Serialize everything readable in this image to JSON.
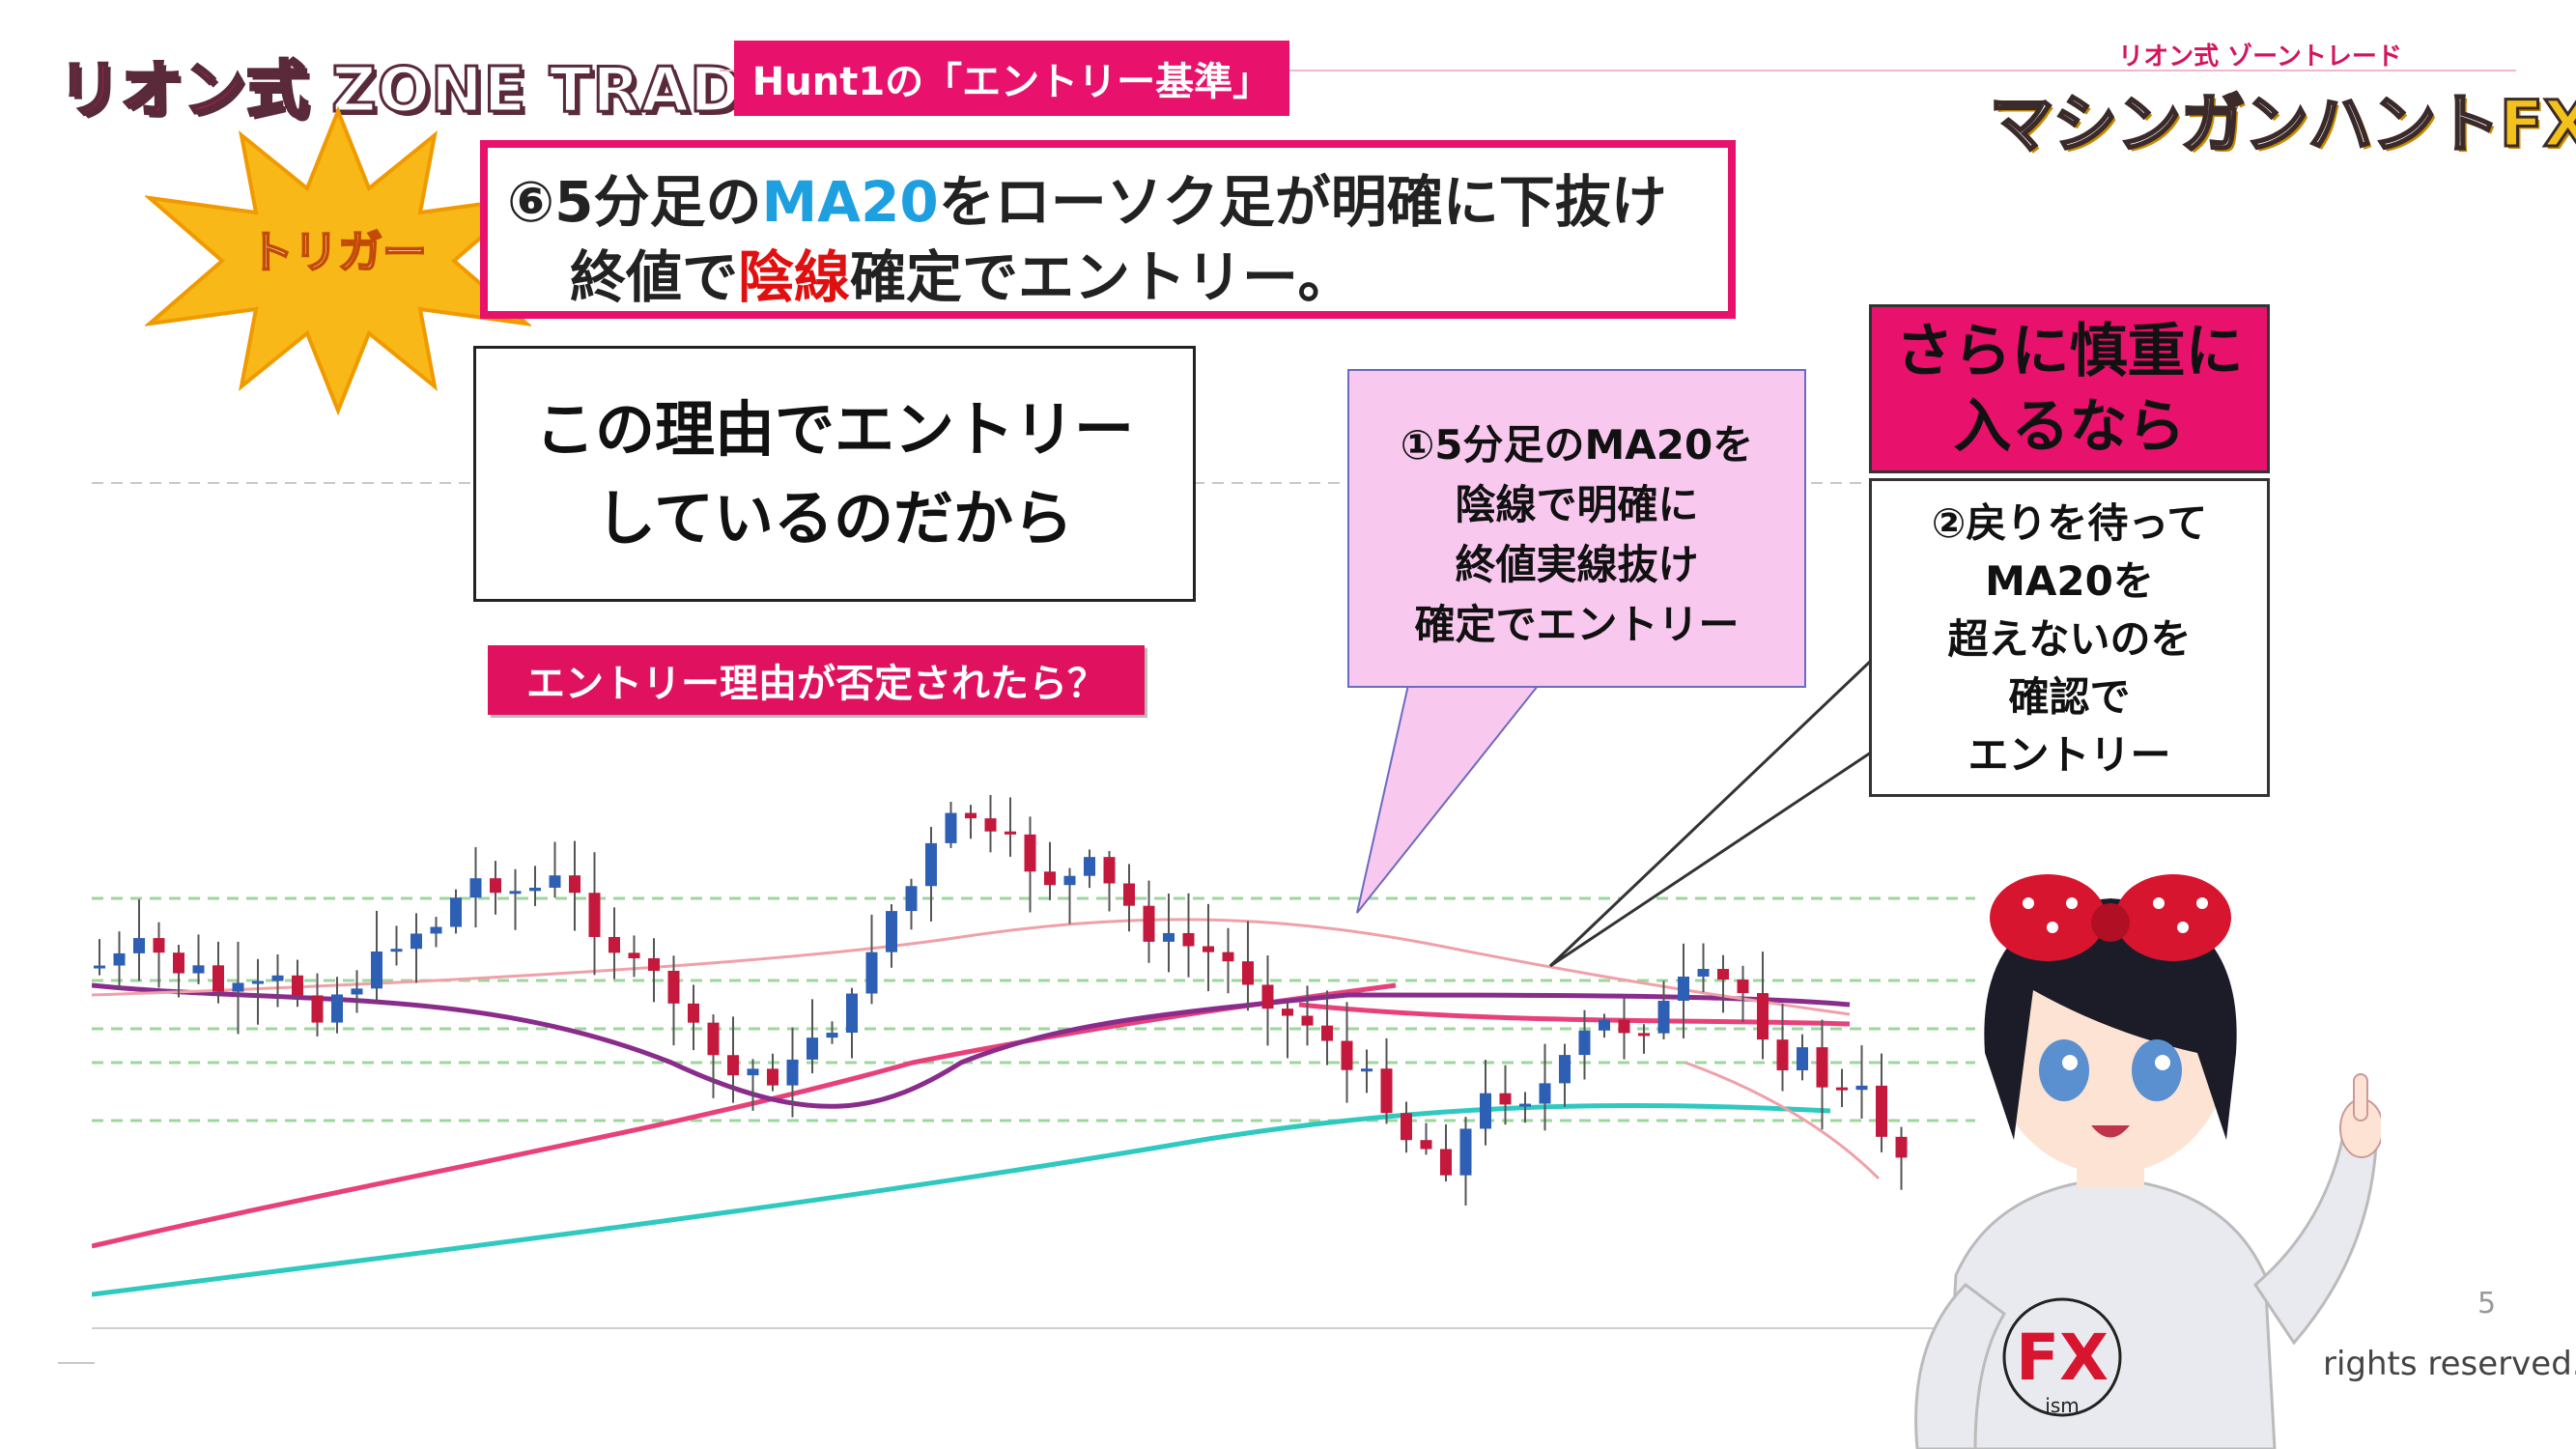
{
  "header": {
    "logo_part1": "リオン式",
    "logo_part2": "ZONE TRADE",
    "tab_label": "Hunt1の「エントリー基準」"
  },
  "brand": {
    "subtitle": "リオン式 ゾーントレード",
    "title_main": "マシンガンハント",
    "title_fx": "FX",
    "icon": "bar-chart-icon"
  },
  "trigger": {
    "badge": "トリガー",
    "line1_pre": "⑥5分足の",
    "line1_ma": "MA20",
    "line1_post": "をローソク足が明確に下抜け",
    "line2_pre": "終値で",
    "line2_red": "陰線",
    "line2_post": "確定でエントリー。"
  },
  "reason": {
    "line1": "この理由でエントリー",
    "line2": "しているのだから"
  },
  "denied_label": "エントリー理由が否定されたら？",
  "bubble1": {
    "lines": [
      "①5分足のMA20を",
      "陰線で明確に",
      "終値実線抜け",
      "確定でエントリー"
    ]
  },
  "careful": {
    "line1": "さらに慎重に",
    "line2": "入るなら"
  },
  "bubble2": {
    "lines": [
      "②戻りを待って",
      "MA20を",
      "超えないのを",
      "確認で",
      "エントリー"
    ]
  },
  "mascot": {
    "shirt_text": "FX",
    "shirt_sub": "ism"
  },
  "page_number": "5",
  "copyright": "rights reserved.",
  "colors": {
    "accent": "#e8116b",
    "ma_blue": "#1ea0e0",
    "bearish_red": "#e01010",
    "bubble_pink": "#f9c8ef",
    "star_yellow": "#f7b818",
    "candle_up": "#2d5fb4",
    "candle_down": "#c4183c",
    "ma_purple": "#8a2c8c",
    "ma_pink": "#e8417a",
    "ma_cyan": "#2fc9c0",
    "ma_light": "#f0a0a8"
  }
}
